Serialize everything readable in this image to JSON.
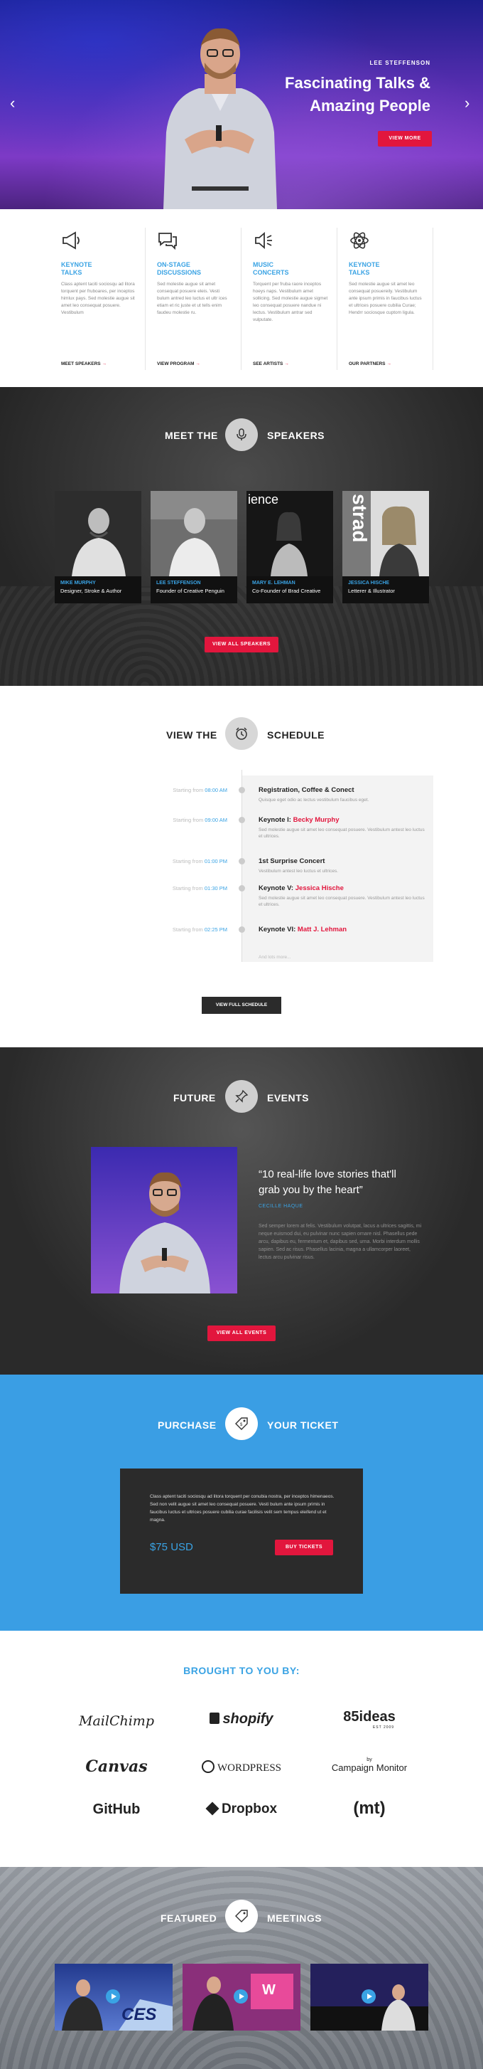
{
  "hero": {
    "kicker": "LEE STEFFENSON",
    "title_line1": "Fascinating Talks &",
    "title_line2": "Amazing People",
    "button": "VIEW MORE",
    "prev": "‹",
    "next": "›"
  },
  "features": [
    {
      "icon": "megaphone-icon",
      "title": "KEYNOTE TALKS",
      "text": "Class aptent taciti sociosqu ad litora torquent per fruboares, per inceptos himlux pays. Sed molestie augue sit amet leo consequat posuere. Vestibulum",
      "link": "MEET SPEAKERS"
    },
    {
      "icon": "chat-bubbles-icon",
      "title": "ON-STAGE DISCUSSIONS",
      "text": "Sed molestie augue sit amet consequat posuere eleis. Vesti bulum antred leo luctus et ultr ices etiam et ric juste et ut tells enim faudeu molestie ru.",
      "link": "VIEW PROGRAM"
    },
    {
      "icon": "speaker-icon",
      "title": "MUSIC CONCERTS",
      "text": "Torquent per fruba raore inceptos hoeys naps. Vestibulum amet sollicing. Sed molestie augue sigmet leo consequat posuere nandue ni lectus. Vestibulum antrar sed vulputate.",
      "link": "SEE ARTISTS"
    },
    {
      "icon": "atom-icon",
      "title": "KEYNOTE TALKS",
      "text": "Sed molestie augue sit amet leo consequat posuereily. Vestibulum ante ipsum primis in faucibus luctus et ultrices posuere cubilia Curae; Hendrr sociosque cuptom ligula.",
      "link": "OUR PARTNERS"
    }
  ],
  "speakers": {
    "heading_left": "MEET THE",
    "heading_right": "SPEAKERS",
    "button": "VIEW ALL SPEAKERS",
    "list": [
      {
        "name": "MIKE MURPHY",
        "role": "Designer, Stroke & Author"
      },
      {
        "name": "LEE STEFFENSON",
        "role": "Founder of Creative Penguin"
      },
      {
        "name": "MARY E. LEHMAN",
        "role": "Co-Founder of Brad Creative"
      },
      {
        "name": "JESSICA HISCHE",
        "role": "Letterer & Illustrator"
      }
    ],
    "photo_text": [
      "ience",
      "strad"
    ]
  },
  "schedule": {
    "heading_left": "VIEW THE",
    "heading_right": "SCHEDULE",
    "button": "VIEW FULL SCHEDULE",
    "more": "And lots more...",
    "items": [
      {
        "starting": "Starting from",
        "time": "08:00 AM",
        "title": "Registration, Coffee & Conect",
        "speaker": "",
        "desc": "Quisque eget odio ac lectus vestibulum faucibus eget."
      },
      {
        "starting": "Starting from",
        "time": "09:00 AM",
        "title": "Keynote I:",
        "speaker": "Becky Murphy",
        "desc": "Sed molestie augue sit amet leo consequat posuere. Vestibulum antest leo luctus et ultrices."
      },
      {
        "starting": "Starting from",
        "time": "01:00 PM",
        "title": "1st Surprise Concert",
        "speaker": "",
        "desc": "Vestibulum antest leo luctus et ultrices."
      },
      {
        "starting": "Starting from",
        "time": "01:30 PM",
        "title": "Keynote V:",
        "speaker": "Jessica Hische",
        "desc": "Sed molestie augue sit amet leo consequat posuere. Vestibulum antest leo luctus et ultrices."
      },
      {
        "starting": "Starting from",
        "time": "02:25 PM",
        "title": "Keynote VI:",
        "speaker": "Matt J. Lehman",
        "desc": ""
      }
    ]
  },
  "events": {
    "heading_left": "FUTURE",
    "heading_right": "EVENTS",
    "quote_line1": "“10 real-life love stories that'll",
    "quote_line2": "grab you by the heart”",
    "author": "CECILLE HAQUE",
    "text": "Sed semper lorem at felis. Vestibulum volutpat, lacus a ultrices sagittis, mi neque euismod dui, eu pulvinar nunc sapien ornare nisl. Phasellus pede arcu, dapibus eu, fermentum et, dapibus sed, urna. Morbi interdum mollis sapien. Sed ac risus. Phasellus lacinia, magna a ullamcorper laoreet, lectus arcu pulvinar risus.",
    "button": "VIEW ALL EVENTS"
  },
  "ticket": {
    "heading_left": "PURCHASE",
    "heading_right": "YOUR TICKET",
    "text": "Class aptent taciti sociosqu ad litora torquent per conubia nostra, per inceptos himenaeos. Sed non velit augue sit amet leo consequat posuere. Vesti bulum ante ipsum primis in faucibus luctus et ultrices posuere cubilia curae facilisis velit sem tempus eleifend ut et magna.",
    "price": "$75 USD",
    "button": "BUY TICKETS"
  },
  "sponsors": {
    "heading": "BROUGHT TO YOU BY:",
    "logos": [
      "MailChimp",
      "shopify",
      "85ideas",
      "Canvas",
      "WORDPRESS",
      "Campaign Monitor",
      "GitHub",
      "Dropbox",
      "(mt)"
    ],
    "logo_sub": {
      "ideas": "EST 2009",
      "cm": "by"
    }
  },
  "meetings": {
    "heading_left": "FEATURED",
    "heading_right": "MEETINGS",
    "stage_texts": [
      "CES",
      "W"
    ]
  },
  "colors": {
    "accent_red": "#e2163d",
    "accent_blue": "#3aa3e4",
    "ticket_bg": "#3a9ee4",
    "dark_bg": "#2b2b2b"
  }
}
